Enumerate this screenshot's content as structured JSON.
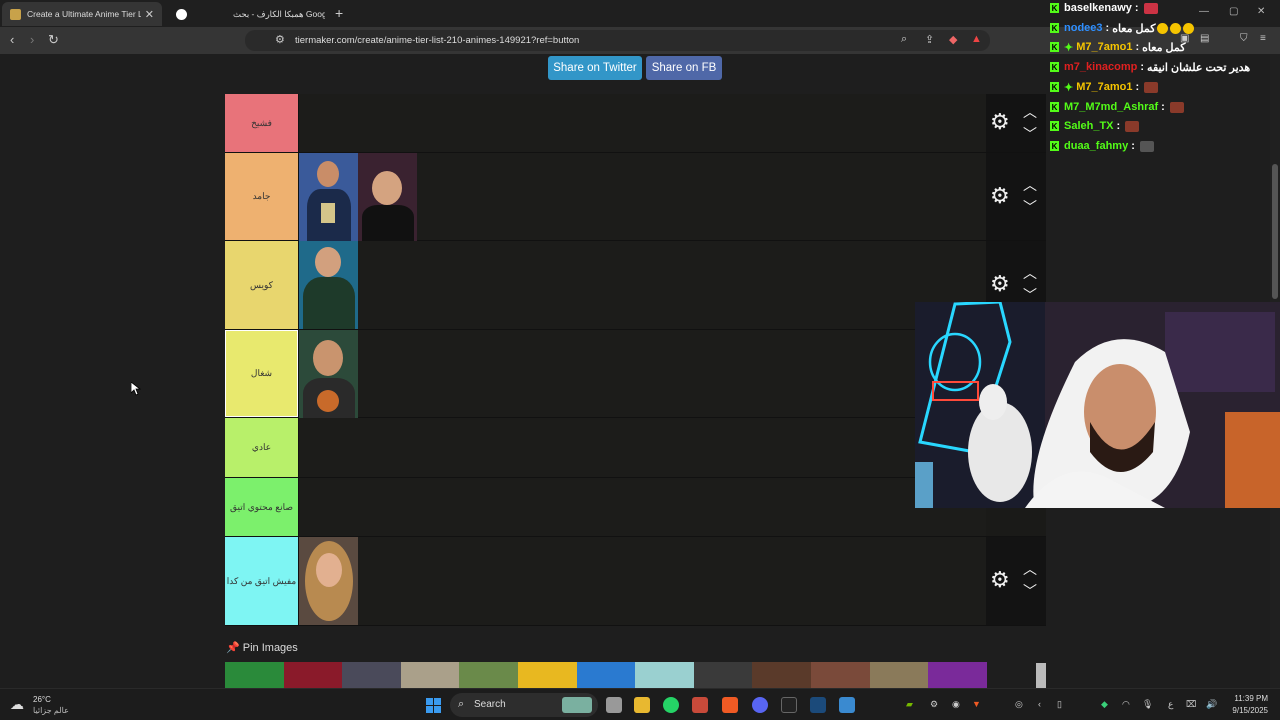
{
  "browser": {
    "tabs": [
      {
        "title": "Create a Ultimate Anime Tier List"
      },
      {
        "title": "همبكا الكارف - بحث Google"
      }
    ],
    "url": "tiermaker.com/create/anime-tier-list-210-animes-149921?ref=button"
  },
  "share": {
    "twitter": "Share on Twitter",
    "facebook": "Share on FB"
  },
  "tiers": [
    {
      "label": "فشيخ",
      "color": "#e8737a"
    },
    {
      "label": "جامد",
      "color": "#eeb170"
    },
    {
      "label": "كويس",
      "color": "#e8d66e"
    },
    {
      "label": "شغال",
      "color": "#e8e96e"
    },
    {
      "label": "عادي",
      "color": "#b8f06a"
    },
    {
      "label": "صانع محتوي اتيق",
      "color": "#7cf06c"
    },
    {
      "label": "مفيش اتيق من كدا",
      "color": "#7ef5f3"
    }
  ],
  "pin": {
    "label": "Pin Images",
    "icon": "pushpin-icon"
  },
  "chat": [
    {
      "user": "baselkenawy",
      "color": "#ffffff",
      "text": ""
    },
    {
      "user": "nodee3",
      "color": "#2e8fff",
      "text": "كمل معاه"
    },
    {
      "user": "M7_7amo1",
      "color": "#f5c400",
      "text": "كمل معاه"
    },
    {
      "user": "m7_kinacomp",
      "color": "#e02020",
      "text": "هدير تحت علشان انيقه"
    },
    {
      "user": "M7_7amo1",
      "color": "#f5c400",
      "text": ""
    },
    {
      "user": "M7_M7md_Ashraf",
      "color": "#53fc18",
      "text": ""
    },
    {
      "user": "Saleh_TX",
      "color": "#53fc18",
      "text": ""
    },
    {
      "user": "duaa_fahmy",
      "color": "#53fc18",
      "text": ""
    }
  ],
  "taskbar": {
    "weather_temp": "26°C",
    "weather_desc": "عالم جزائيا",
    "search": "Search",
    "time": "11:39 PM",
    "date": "9/15/2025"
  }
}
